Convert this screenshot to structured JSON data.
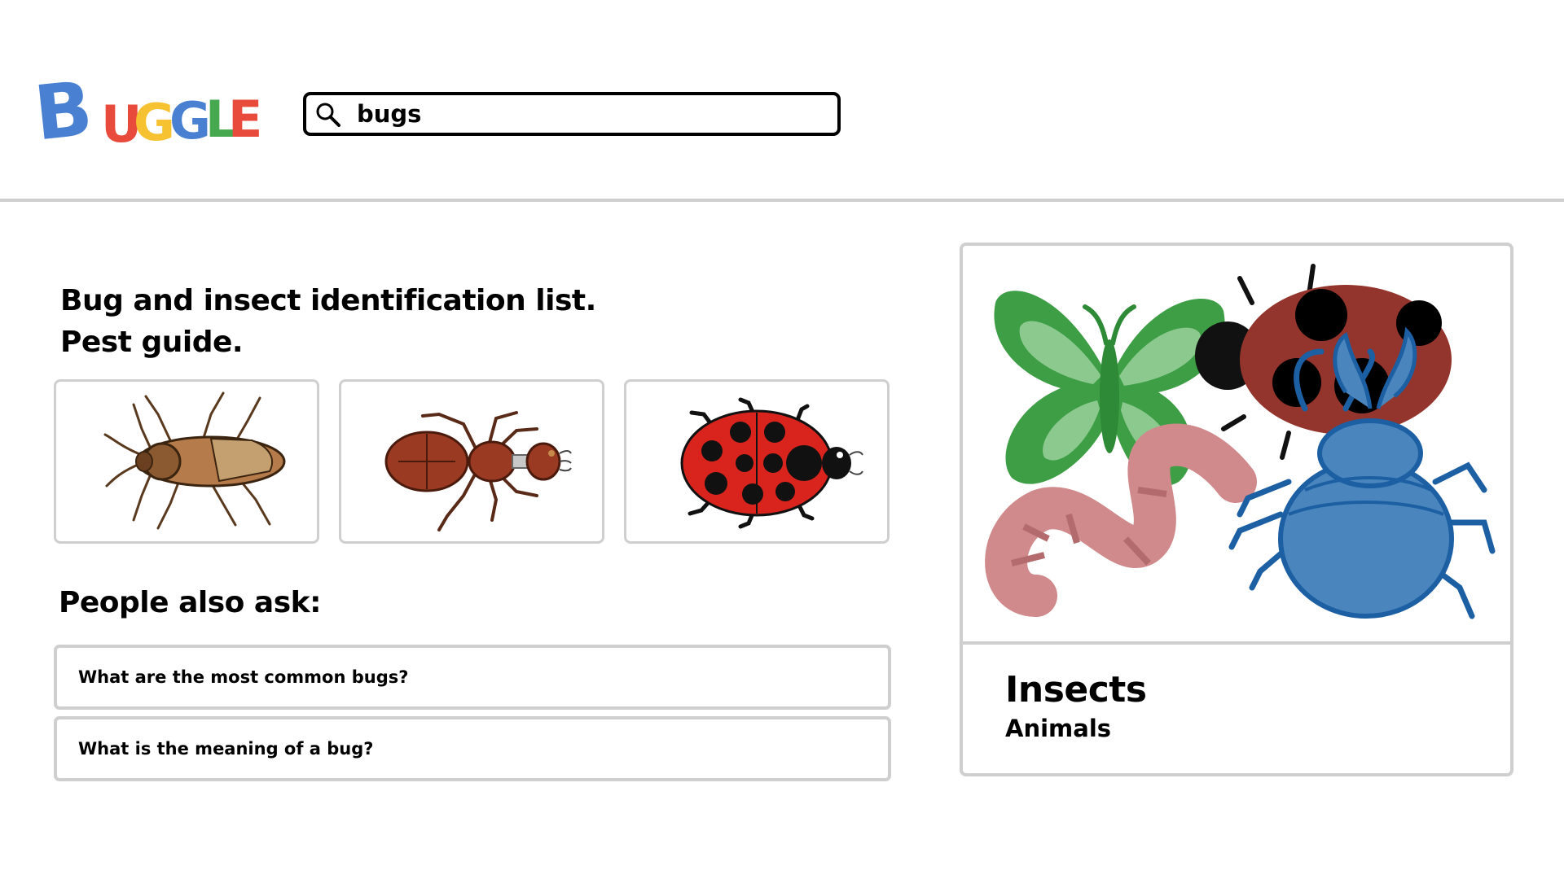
{
  "logo": {
    "text": "BUGGLE",
    "colors": [
      "#4a80d2",
      "#4a80d2",
      "#e84b3c",
      "#f6c232",
      "#4a80d2",
      "#47a94f",
      "#e84b3c"
    ]
  },
  "search": {
    "query": "bugs",
    "icon": "search-icon"
  },
  "result": {
    "title_line1": "Bug and insect identification list.",
    "title_line2": "Pest guide.",
    "images": [
      {
        "name": "cockroach"
      },
      {
        "name": "ant"
      },
      {
        "name": "ladybug"
      }
    ]
  },
  "people_also_ask": {
    "heading": "People also ask:",
    "questions": [
      "What are the most common bugs?",
      "What is the meaning of a bug?"
    ]
  },
  "knowledge_panel": {
    "title": "Insects",
    "subtitle": "Animals",
    "image": "insects-illustration"
  },
  "colors": {
    "divider": "#cfcfcf",
    "border": "#cfcfcf"
  }
}
